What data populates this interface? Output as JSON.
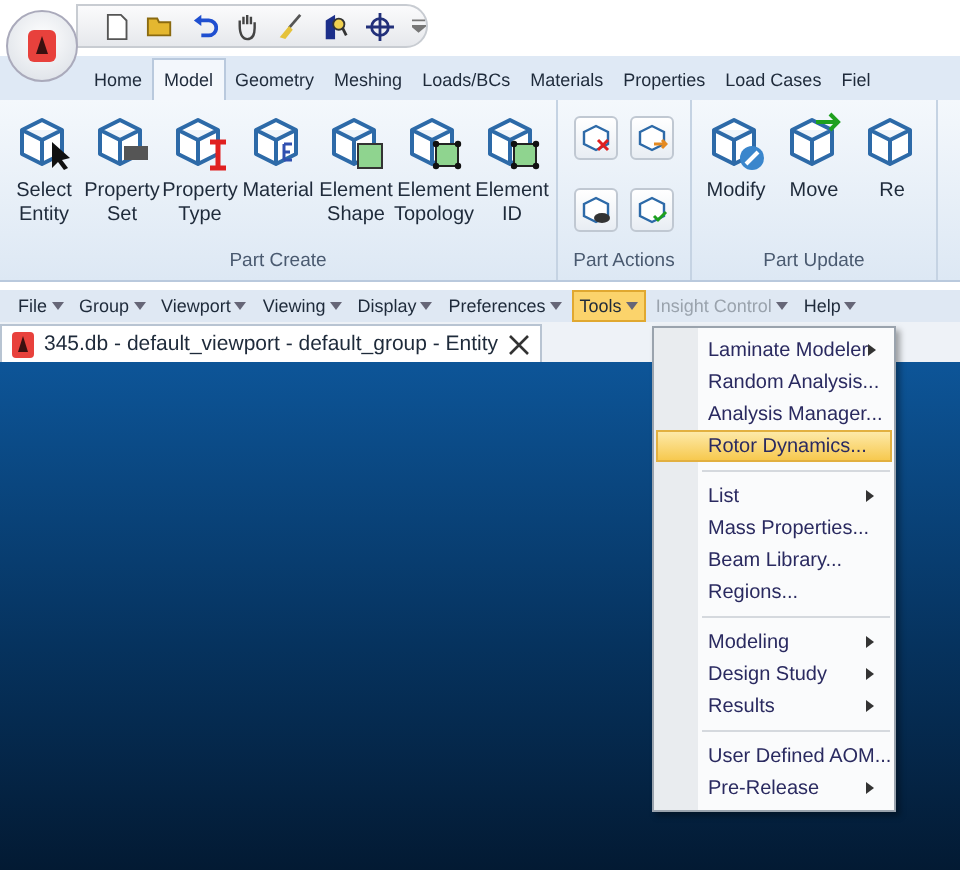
{
  "ribbon_tabs": [
    {
      "label": "Home",
      "selected": false
    },
    {
      "label": "Model",
      "selected": true
    },
    {
      "label": "Geometry",
      "selected": false
    },
    {
      "label": "Meshing",
      "selected": false
    },
    {
      "label": "Loads/BCs",
      "selected": false
    },
    {
      "label": "Materials",
      "selected": false
    },
    {
      "label": "Properties",
      "selected": false
    },
    {
      "label": "Load Cases",
      "selected": false
    },
    {
      "label": "Fiel",
      "selected": false
    }
  ],
  "ribbon_groups": [
    {
      "title": "Part Create",
      "buttons": [
        {
          "label": "Select Entity"
        },
        {
          "label": "Property Set"
        },
        {
          "label": "Property Type"
        },
        {
          "label": "Material"
        },
        {
          "label": "Element Shape"
        },
        {
          "label": "Element Topology"
        },
        {
          "label": "Element ID"
        }
      ]
    },
    {
      "title": "Part Actions"
    },
    {
      "title": "Part Update",
      "buttons": [
        {
          "label": "Modify"
        },
        {
          "label": "Move"
        },
        {
          "label": "Re"
        }
      ]
    }
  ],
  "menu_bar": [
    {
      "label": "File",
      "selected": false,
      "disabled": false
    },
    {
      "label": "Group",
      "selected": false,
      "disabled": false
    },
    {
      "label": "Viewport",
      "selected": false,
      "disabled": false
    },
    {
      "label": "Viewing",
      "selected": false,
      "disabled": false
    },
    {
      "label": "Display",
      "selected": false,
      "disabled": false
    },
    {
      "label": "Preferences",
      "selected": false,
      "disabled": false
    },
    {
      "label": "Tools",
      "selected": true,
      "disabled": false
    },
    {
      "label": "Insight Control",
      "selected": false,
      "disabled": true
    },
    {
      "label": "Help",
      "selected": false,
      "disabled": false
    }
  ],
  "document_tab": {
    "title": "345.db - default_viewport - default_group - Entity"
  },
  "tools_menu": [
    [
      {
        "label": "Laminate Modeler",
        "submenu": true,
        "selected": false
      },
      {
        "label": "Random Analysis...",
        "submenu": false,
        "selected": false
      },
      {
        "label": "Analysis Manager...",
        "submenu": false,
        "selected": false
      },
      {
        "label": "Rotor Dynamics...",
        "submenu": false,
        "selected": true
      }
    ],
    [
      {
        "label": "List",
        "submenu": true,
        "selected": false
      },
      {
        "label": "Mass Properties...",
        "submenu": false,
        "selected": false
      },
      {
        "label": "Beam Library...",
        "submenu": false,
        "selected": false
      },
      {
        "label": "Regions...",
        "submenu": false,
        "selected": false
      }
    ],
    [
      {
        "label": "Modeling",
        "submenu": true,
        "selected": false
      },
      {
        "label": "Design Study",
        "submenu": true,
        "selected": false
      },
      {
        "label": "Results",
        "submenu": true,
        "selected": false
      }
    ],
    [
      {
        "label": "User Defined AOM...",
        "submenu": false,
        "selected": false
      },
      {
        "label": "Pre-Release",
        "submenu": true,
        "selected": false
      }
    ]
  ]
}
